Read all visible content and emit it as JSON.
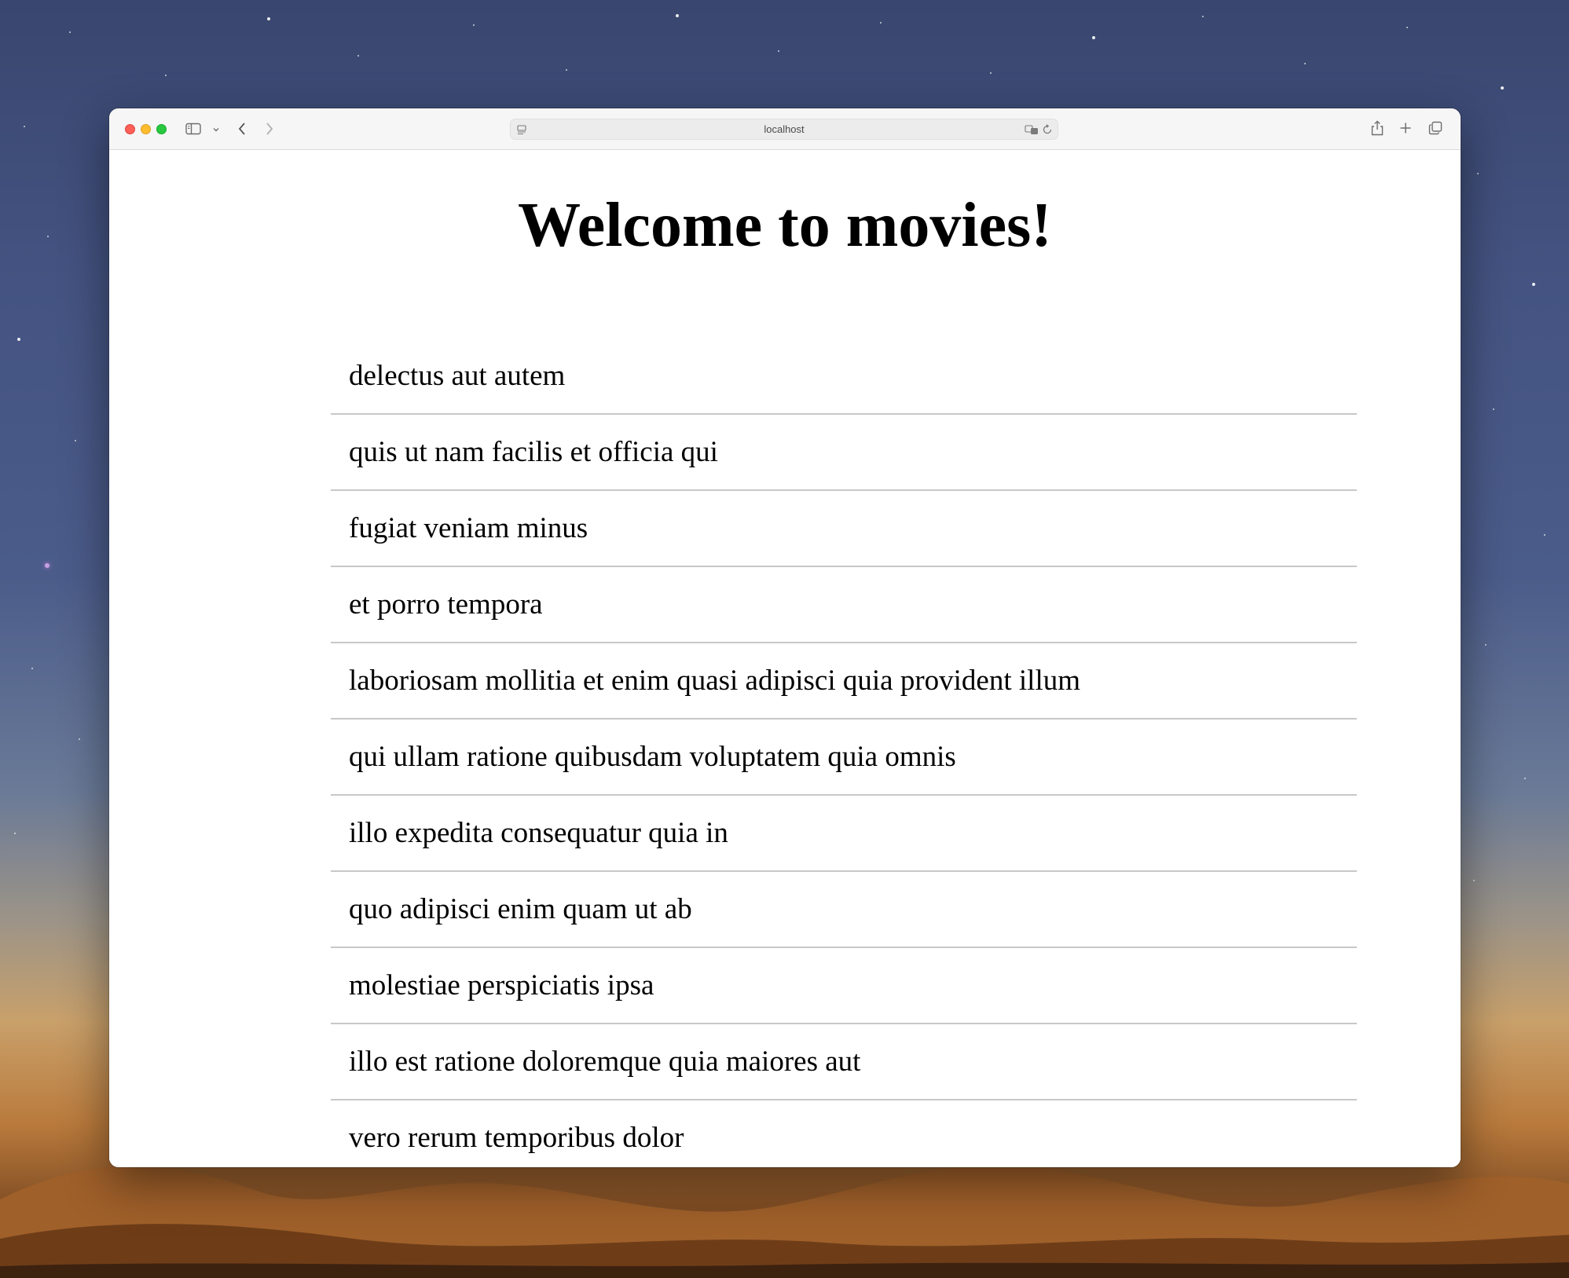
{
  "browser": {
    "url": "localhost",
    "icons": {
      "close": "close-button",
      "minimize": "minimize-button",
      "zoom": "zoom-button",
      "sidebar": "sidebar-icon",
      "sidebar_menu": "chevron-down-icon",
      "back": "chevron-left-icon",
      "forward": "chevron-right-icon",
      "site": "page-icon",
      "translate": "translate-icon",
      "reload": "reload-icon",
      "share": "share-icon",
      "new_tab": "plus-icon",
      "tab_overview": "tabs-icon"
    },
    "colors": {
      "close": "#fe5f57",
      "minimize": "#febc2e",
      "zoom": "#28c840"
    }
  },
  "page": {
    "title": "Welcome to movies!",
    "movies": [
      "delectus aut autem",
      "quis ut nam facilis et officia qui",
      "fugiat veniam minus",
      "et porro tempora",
      "laboriosam mollitia et enim quasi adipisci quia provident illum",
      "qui ullam ratione quibusdam voluptatem quia omnis",
      "illo expedita consequatur quia in",
      "quo adipisci enim quam ut ab",
      "molestiae perspiciatis ipsa",
      "illo est ratione doloremque quia maiores aut",
      "vero rerum temporibus dolor"
    ]
  }
}
